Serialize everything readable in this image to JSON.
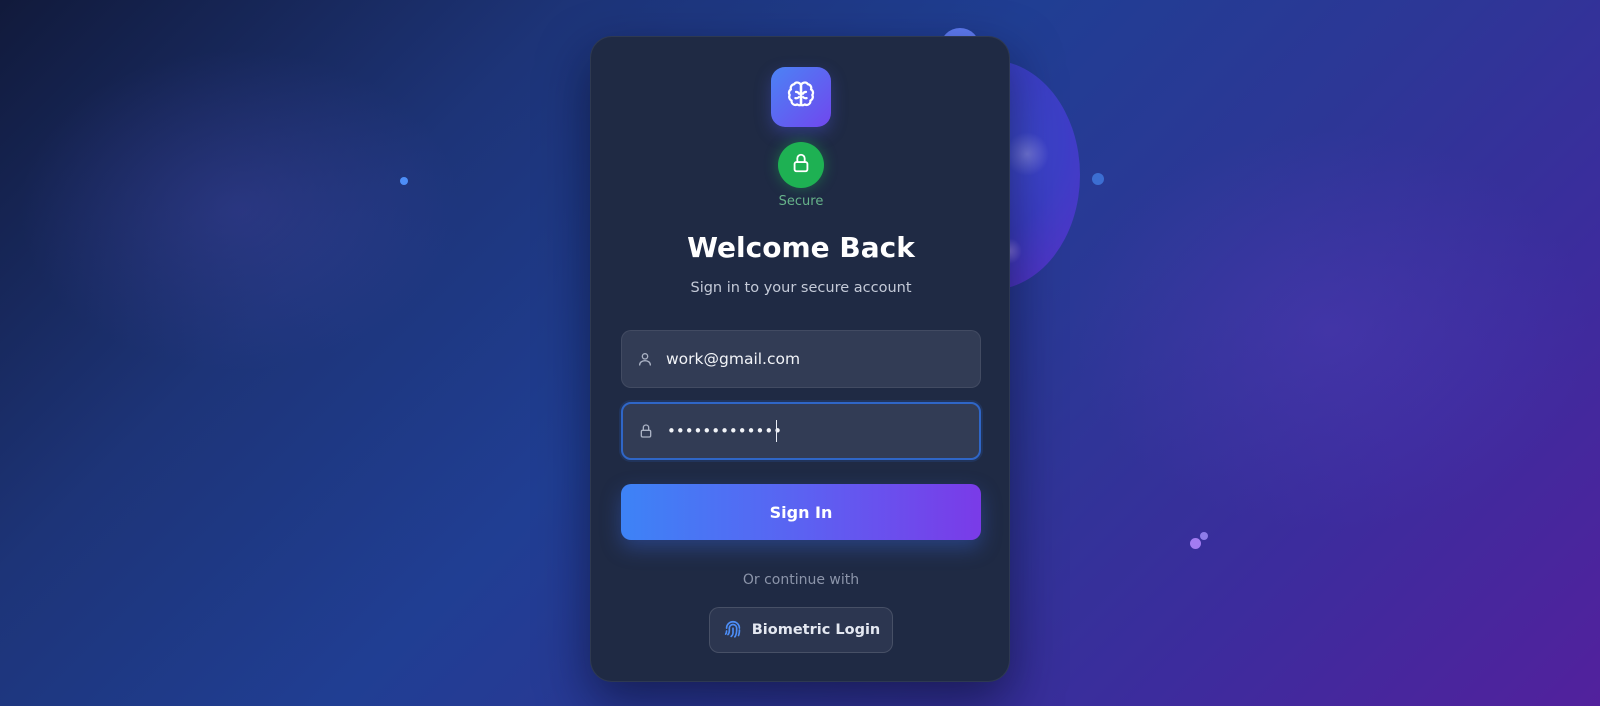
{
  "brand": {
    "logo_icon": "brain-icon",
    "accent_gradient": [
      "#4b83f5",
      "#7047ee"
    ]
  },
  "security": {
    "badge_icon": "lock-icon",
    "label": "Secure",
    "color": "#1eb153"
  },
  "header": {
    "title": "Welcome Back",
    "subtitle": "Sign in to your secure account"
  },
  "form": {
    "email": {
      "icon": "user-icon",
      "value": "work@gmail.com"
    },
    "password": {
      "icon": "lock-icon",
      "value": "•••••••••••••"
    },
    "submit_label": "Sign In"
  },
  "alternatives": {
    "divider_text": "Or continue with",
    "biometric": {
      "icon": "fingerprint-icon",
      "label": "Biometric Login"
    }
  }
}
